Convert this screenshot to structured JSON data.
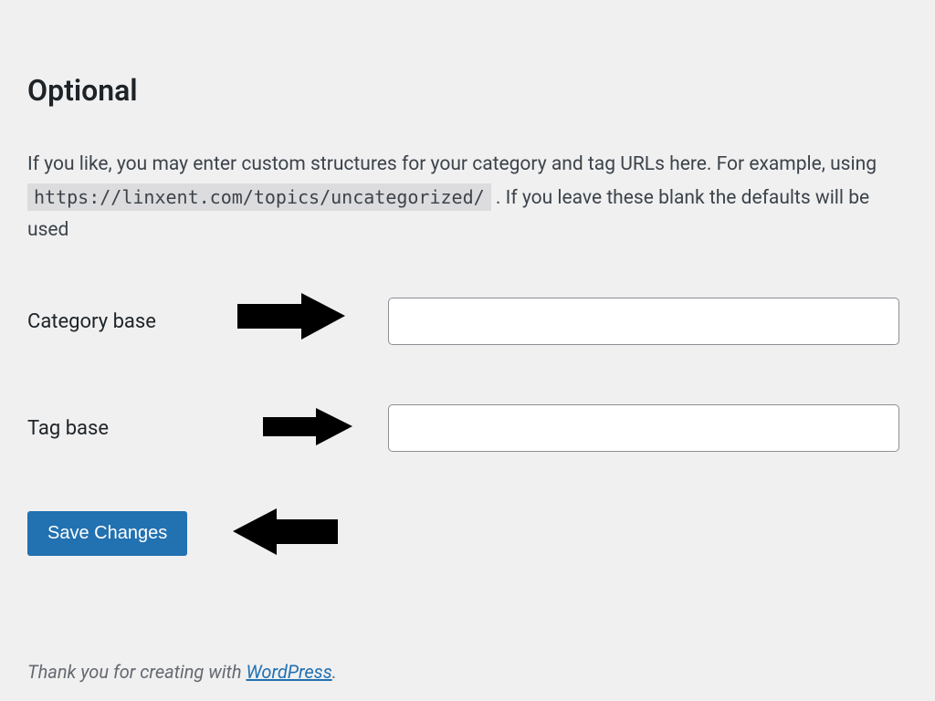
{
  "heading": "Optional",
  "description": {
    "part1": "If you like, you may enter custom structures for your category and tag URLs here. For example, using ",
    "code_example": "https://linxent.com/topics/uncategorized/",
    "part2": " . If you leave these blank the defaults will be used"
  },
  "fields": {
    "category_base": {
      "label": "Category base",
      "value": ""
    },
    "tag_base": {
      "label": "Tag base",
      "value": ""
    }
  },
  "button": {
    "save_label": "Save Changes"
  },
  "footer": {
    "text_before": "Thank you for creating with ",
    "link_text": "WordPress",
    "text_after": "."
  }
}
